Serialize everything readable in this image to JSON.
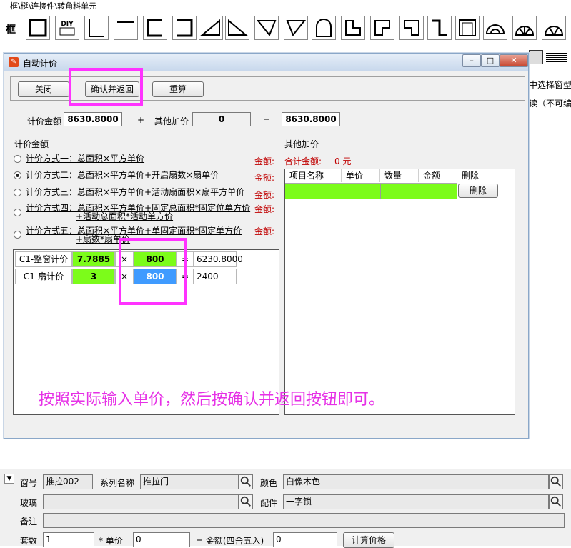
{
  "app": {
    "menu_path": "框\\梃\\连接件\\转角料单元",
    "frame_label": "框",
    "right_panel": {
      "line1": "中选择窗型",
      "line2": "读（不可编辑"
    }
  },
  "dialog": {
    "title": "自动计价",
    "buttons": {
      "close": "关闭",
      "confirm_return": "确认并返回",
      "recalc": "重算"
    },
    "price_label": "计价金额",
    "price_value": "8630.8000",
    "plus": "+",
    "other_label": "其他加价",
    "other_value": "0",
    "equals": "=",
    "total_value": "8630.8000",
    "pricing_group_title": "计价金额",
    "methods": [
      {
        "label": "计价方式一：总面积×平方单价",
        "label2": "",
        "selected": false,
        "amount_label": "金额:"
      },
      {
        "label": "计价方式二：总面积×平方单价+开启扇数×扇单价",
        "label2": "",
        "selected": true,
        "amount_label": "金额:"
      },
      {
        "label": "计价方式三：总面积×平方单价+活动扇面积×扇平方单价",
        "label2": "",
        "selected": false,
        "amount_label": "金额:"
      },
      {
        "label": "计价方式四：总面积×平方单价+固定总面积*固定位单方价",
        "label2": "+活动总面积*活动单方价",
        "selected": false,
        "amount_label": "金额:"
      },
      {
        "label": "计价方式五：总面积×平方单价+单固定面积*固定单方价",
        "label2": "+扇数*扇单价",
        "selected": false,
        "amount_label": "金额:"
      }
    ],
    "calc_rows": [
      {
        "name": "C1-整窗计价",
        "qty": "7.7885",
        "op": "×",
        "price": "800",
        "eq": "=",
        "result": "6230.8000"
      },
      {
        "name": "C1-扇计价",
        "qty": "3",
        "op": "×",
        "price": "800",
        "eq": "=",
        "result": "2400"
      }
    ],
    "other_group_title": "其他加价",
    "other_total_label": "合计金额:",
    "other_total_value": "0 元",
    "other_table": {
      "headers": [
        "项目名称",
        "单价",
        "数量",
        "金额",
        "删除"
      ],
      "delete_button": "删除"
    },
    "annotation": "按照实际输入单价，然后按确认并返回按钮即可。"
  },
  "form": {
    "window_no_label": "窗号",
    "window_no": "推拉002",
    "series_label": "系列名称",
    "series": "推拉门",
    "color_label": "颜色",
    "color": "白像木色",
    "glass_label": "玻璃",
    "glass": "",
    "parts_label": "配件",
    "parts": "一字锁",
    "remark_label": "备注",
    "remark": "",
    "sets_label": "套数",
    "sets": "1",
    "unit_price_label": "* 单价",
    "unit_price": "0",
    "amount_label": "= 金额(四舍五入)",
    "amount": "0",
    "calc_button": "计算价格"
  },
  "colors": {
    "highlight": "#ff33ff",
    "green_cell": "#7cfc1a",
    "blue_cell": "#3f9bff",
    "amount_red": "#c00000",
    "annotation": "#e630e6"
  }
}
